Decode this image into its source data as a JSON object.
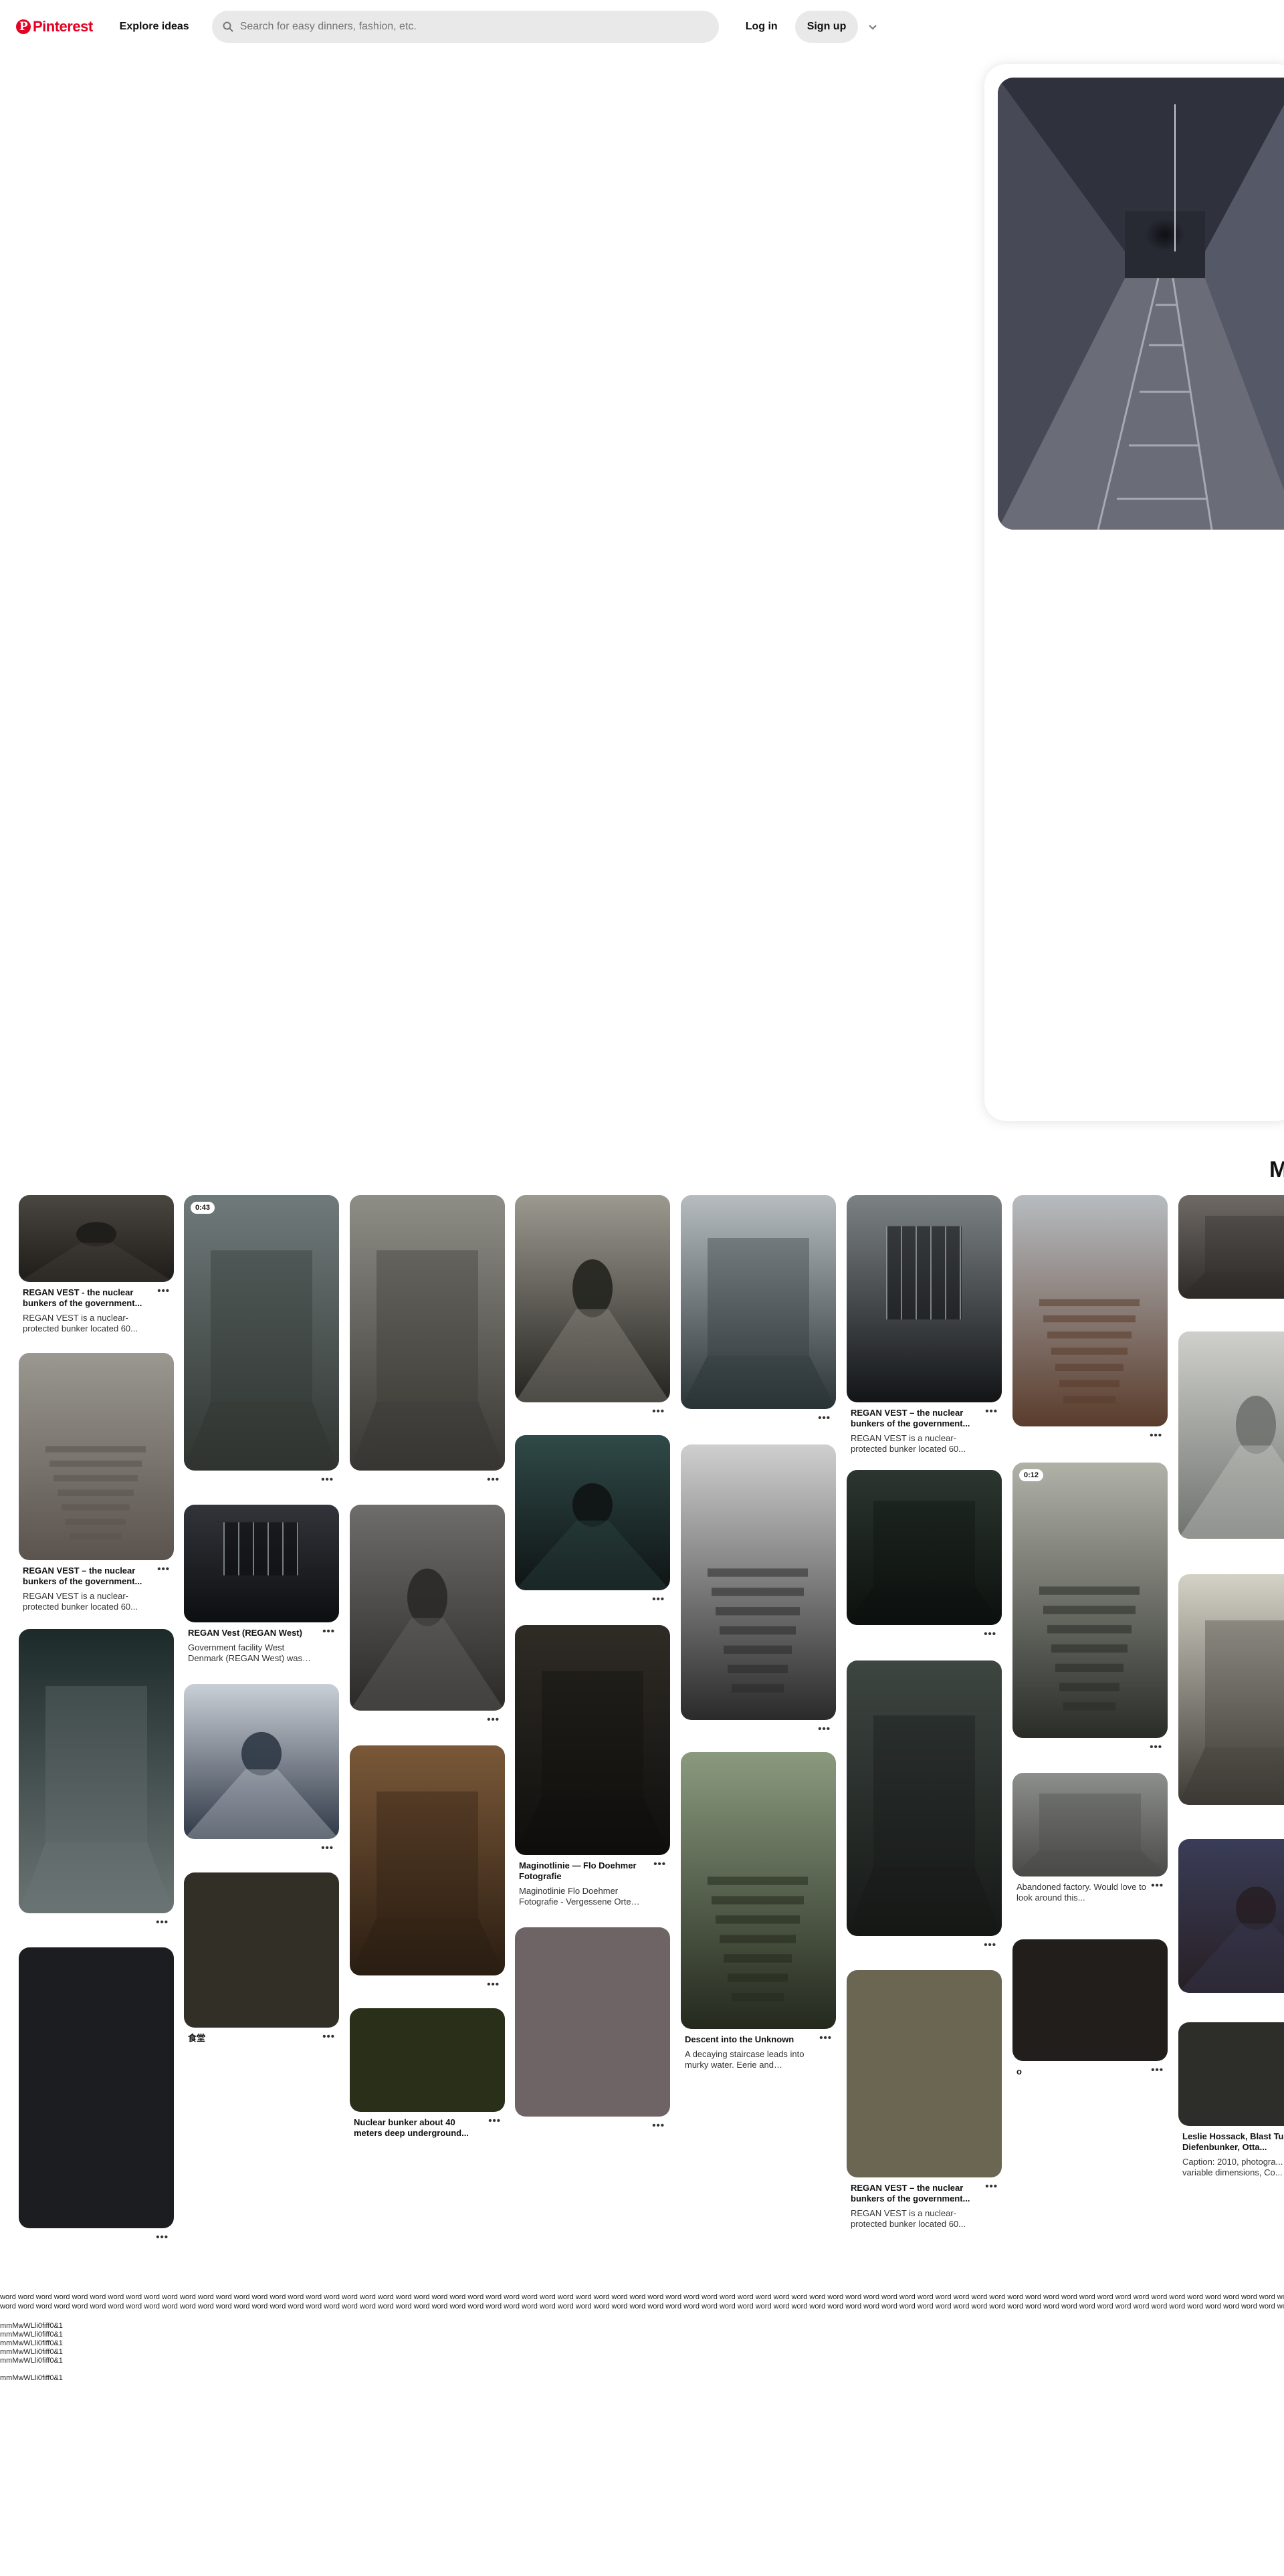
{
  "header": {
    "logo_text": "Pinterest",
    "logo_mark": "P",
    "explore_label": "Explore ideas",
    "search_placeholder": "Search for easy dinners, fashion, etc.",
    "login_label": "Log in",
    "signup_label": "Sign up",
    "icons": {
      "search": "search-icon",
      "more": "chevron-down-icon"
    }
  },
  "closeup": {
    "more_heading": "M"
  },
  "pins": {
    "c1": [
      {
        "title": "REGAN VEST - the nuclear bunkers of the government...",
        "desc": "REGAN VEST is a nuclear-protected bunker located 60..."
      },
      {
        "title": "REGAN VEST – the nuclear bunkers of the government...",
        "desc": "REGAN VEST is a nuclear-protected bunker located 60..."
      },
      {},
      {}
    ],
    "c2": [
      {
        "badge": "0:43"
      },
      {
        "title": "REGAN Vest (REGAN West)",
        "desc": "Government facility West Denmark (REGAN West) was bui..."
      },
      {},
      {
        "title": "食堂"
      }
    ],
    "c3": [
      {},
      {},
      {},
      {
        "title": "Nuclear bunker about 40 meters deep underground..."
      }
    ],
    "c4": [
      {},
      {},
      {
        "title": "Maginotlinie — Flo Doehmer Fotografie",
        "desc": "Maginotlinie Flo Doehmer Fotografie - Vergessene Orte un..."
      },
      {}
    ],
    "c5": [
      {},
      {},
      {
        "title": "Descent into the Unknown",
        "desc": "A decaying staircase leads into murky water. Eerie and decaying..."
      }
    ],
    "c6": [
      {
        "title": "REGAN VEST – the nuclear bunkers of the government...",
        "desc": "REGAN VEST is a nuclear-protected bunker located 60..."
      },
      {},
      {},
      {
        "title": "REGAN VEST – the nuclear bunkers of the government...",
        "desc": "REGAN VEST is a nuclear-protected bunker located 60..."
      }
    ],
    "c7": [
      {},
      {
        "badge": "0:12"
      },
      {
        "desc": "Abandoned factory. Would love to look around this..."
      },
      {
        "title": "o"
      }
    ],
    "c8": [
      {},
      {},
      {},
      {},
      {
        "title": "Leslie Hossack, Blast Tu... The Diefenbunker, Otta...",
        "desc": "Caption: 2010, photogra... variable dimensions, Co..."
      }
    ]
  },
  "footer_noise": {
    "line1": "word word word word word word word word word word word word word word word word word word word word word word word word word word word word word word word word word word word word word word word word word word word word word word word word word word word word word word word word word word word word word word word word word word word word word word word word word word word word word word word word word word word word word word word word word word word word word word word word word",
    "line2": "word word word word word word word word word word word word word word word word word word word word word word word word word word word word word word word word word word word word word word word word word word word word word word word word word word word word word word word word word word word word word word word word word word word word word word word word word word word word word word word word word word word word word word word word word word word word word word word word word word",
    "m1": "mmMwWLli0fiff0&1",
    "m2": "mmMwWLli0fiff0&1",
    "m3": "mmMwWLli0fiff0&1",
    "m4": "mmMwWLli0fiff0&1",
    "m5": "mmMwWLli0fiff0&1",
    "m6": "mmMwWLli0fiff0&1"
  }
}
